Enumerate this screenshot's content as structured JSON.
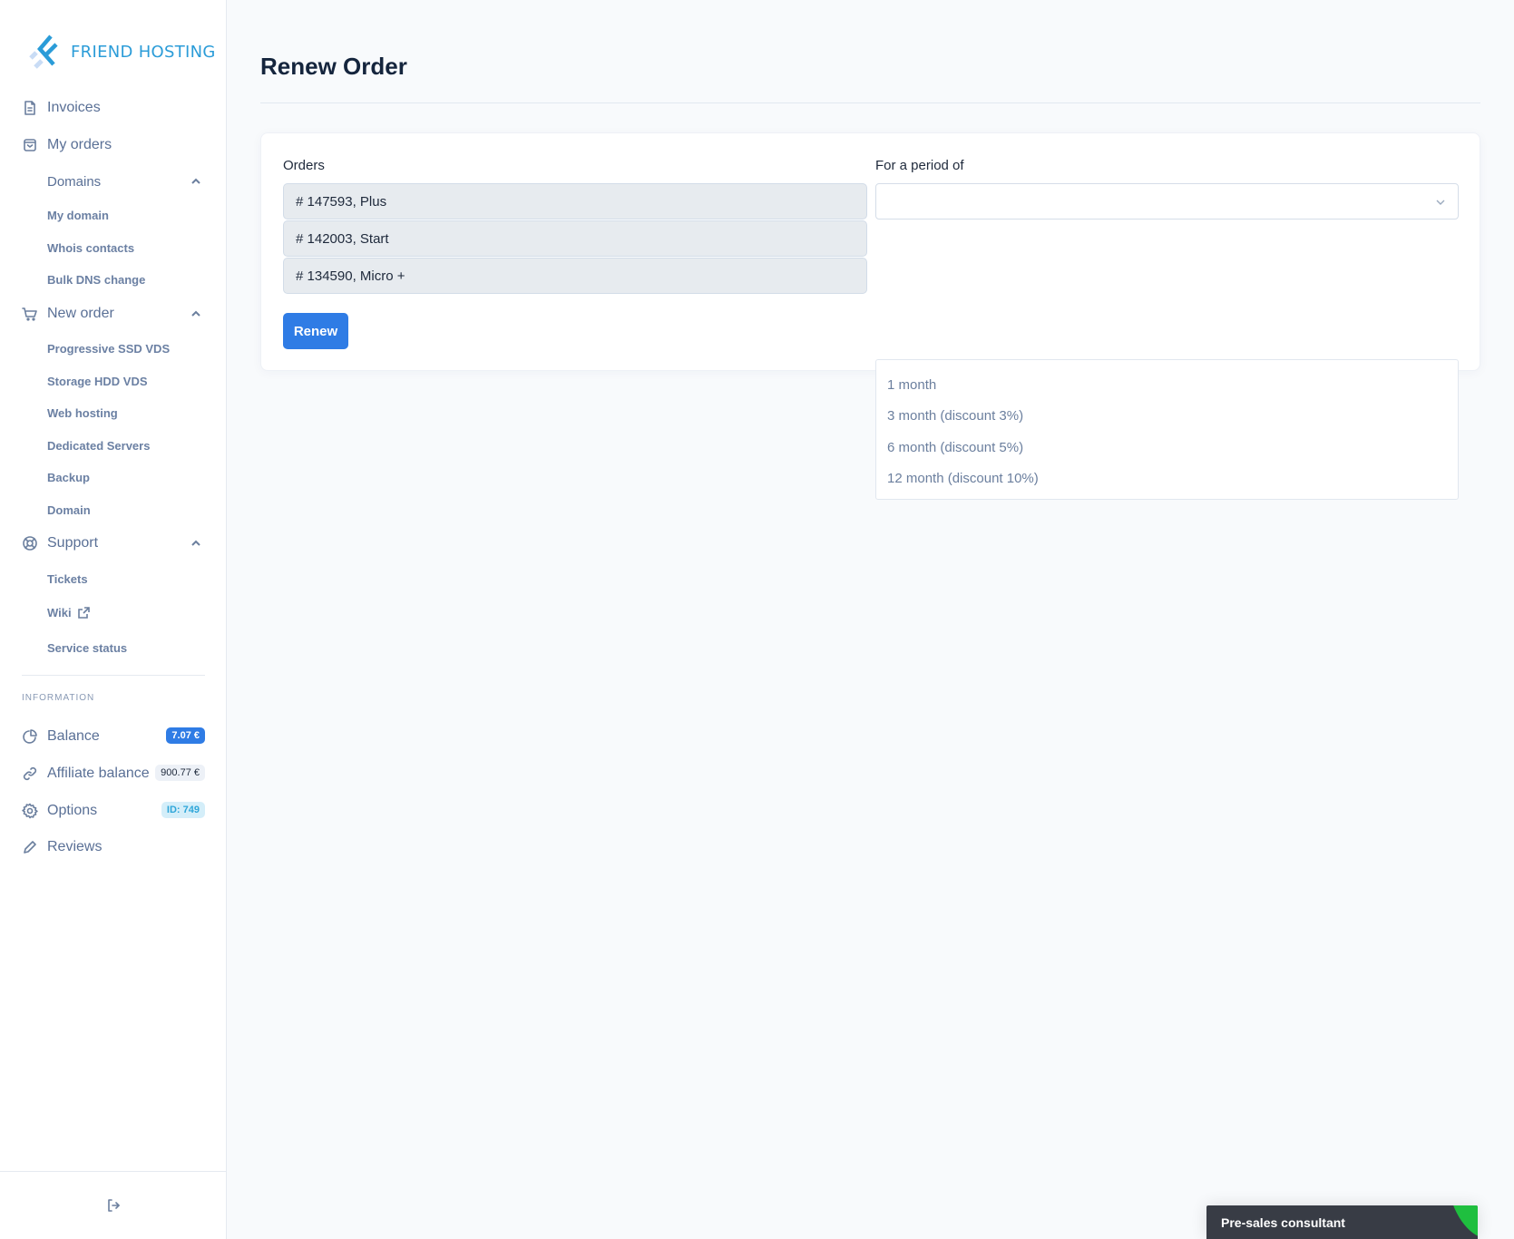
{
  "brand": {
    "name": "FRIEND HOSTING",
    "color": "#2b9cd8"
  },
  "sidebar": {
    "items": [
      {
        "label": "Invoices",
        "icon": "document-icon"
      },
      {
        "label": "My orders",
        "icon": "bag-icon"
      },
      {
        "label": "Domains",
        "expanded": true
      },
      {
        "label": "My domain"
      },
      {
        "label": "Whois contacts"
      },
      {
        "label": "Bulk DNS change"
      },
      {
        "label": "New order",
        "icon": "cart-icon",
        "expanded": true
      },
      {
        "label": "Progressive SSD VDS"
      },
      {
        "label": "Storage HDD VDS"
      },
      {
        "label": "Web hosting"
      },
      {
        "label": "Dedicated Servers"
      },
      {
        "label": "Backup"
      },
      {
        "label": "Domain"
      },
      {
        "label": "Support",
        "icon": "lifebuoy-icon",
        "expanded": true
      },
      {
        "label": "Tickets"
      },
      {
        "label": "Wiki",
        "icon": "external-link-icon"
      },
      {
        "label": "Service status"
      }
    ],
    "info_title": "INFORMATION",
    "info": [
      {
        "label": "Balance",
        "icon": "pie-chart-icon",
        "badge": "7.07 €"
      },
      {
        "label": "Affiliate balance",
        "icon": "link-icon",
        "badge": "900.77 €"
      },
      {
        "label": "Options",
        "icon": "gear-icon",
        "badge": "ID: 749"
      },
      {
        "label": "Reviews",
        "icon": "pencil-icon"
      }
    ],
    "logout_icon": "logout-icon"
  },
  "main": {
    "title": "Renew Order",
    "orders_label": "Orders",
    "orders": [
      "# 147593, Plus",
      "# 142003, Start",
      "# 134590, Micro +"
    ],
    "period_label": "For a period of",
    "period_value": "",
    "period_options": [
      "1 month",
      "3 month (discount 3%)",
      "6 month (discount 5%)",
      "12 month (discount 10%)"
    ],
    "renew_label": "Renew",
    "accent": "#2f7ce5"
  },
  "chat": {
    "label": "Pre-sales consultant",
    "status_color": "#1fbf3f"
  }
}
